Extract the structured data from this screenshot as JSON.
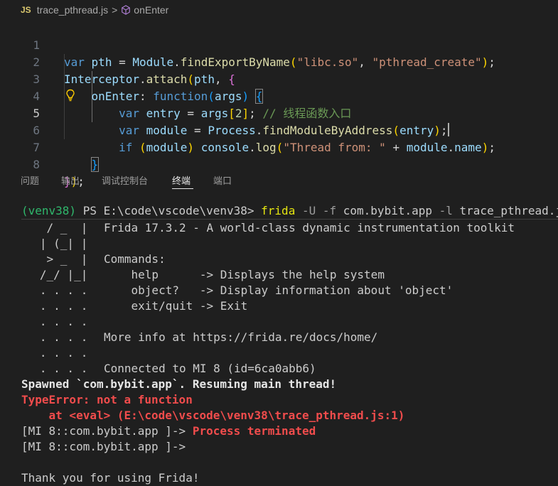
{
  "breadcrumb": {
    "file_badge": "JS",
    "file_name": "trace_pthread.js",
    "separator": ">",
    "symbol": "onEnter"
  },
  "editor": {
    "line_numbers": [
      "1",
      "2",
      "3",
      "4",
      "5",
      "6",
      "7",
      "8"
    ],
    "active_line": "5",
    "line1": {
      "kw": "var",
      "name": "pth",
      "eq": " = ",
      "obj": "Module",
      "dot": ".",
      "fn": "findExportByName",
      "open": "(",
      "s1": "\"libc.so\"",
      "comma": ", ",
      "s2": "\"pthread_create\"",
      "close": ")",
      "semi": ";"
    },
    "line2": {
      "obj": "Interceptor",
      "dot": ".",
      "fn": "attach",
      "open": "(",
      "arg": "pth",
      "comma": ", ",
      "brace": "{"
    },
    "line3": {
      "prop": "onEnter",
      "colon": ": ",
      "kw": "function",
      "open": "(",
      "arg": "args",
      "close": ")",
      "sp": " ",
      "brace": "{"
    },
    "line4": {
      "kw": "var",
      "name": "entry",
      "eq": " = ",
      "arr": "args",
      "lb": "[",
      "idx": "2",
      "rb": "]",
      "semi": ";",
      "comment": " // 线程函数入口"
    },
    "line5": {
      "kw": "var",
      "name": "module",
      "eq": " = ",
      "obj": "Process",
      "dot": ".",
      "fn": "findModuleByAddress",
      "open": "(",
      "arg": "entry",
      "close": ")",
      "semi": ";"
    },
    "line6": {
      "kw": "if",
      "sp": " ",
      "open": "(",
      "arg": "module",
      "close": ")",
      "sp2": " ",
      "obj": "console",
      "dot": ".",
      "fn": "log",
      "open2": "(",
      "str": "\"Thread from: \"",
      "plus": " + ",
      "v1": "module",
      "dot2": ".",
      "v2": "name",
      "close2": ")",
      "semi": ";"
    },
    "line7": {
      "brace": "}"
    },
    "line8": {
      "brace": "}",
      "close": ")",
      "semi": ";"
    }
  },
  "panel": {
    "tabs": [
      "问题",
      "输出",
      "调试控制台",
      "终端",
      "端口"
    ],
    "active_tab": "终端"
  },
  "terminal": {
    "prompt_env": "(venv38)",
    "prompt_ps": " PS E:\\code\\vscode\\venv38> ",
    "cmd": "frida",
    "flag1": " -U -f ",
    "pkg": "com.bybit.app",
    "flag2": " -l ",
    "script": "trace_pthread.js",
    "banner_left": [
      "    / _  |",
      "   | (_| |",
      "    > _  |",
      "   /_/ |_|",
      "   . . . .",
      "   . . . .",
      "   . . . .",
      "   . . . .",
      "   . . . .",
      "   . . . ."
    ],
    "banner_right": [
      "Frida 17.3.2 - A world-class dynamic instrumentation toolkit",
      "",
      "Commands:",
      "    help      -> Displays the help system",
      "    object?   -> Display information about 'object'",
      "    exit/quit -> Exit",
      "",
      "More info at https://frida.re/docs/home/",
      "",
      "Connected to MI 8 (id=6ca0abb6)"
    ],
    "spawned": "Spawned `com.bybit.app`. Resuming main thread!",
    "error": "TypeError: not a function",
    "error_at": "    at <eval> (E:\\code\\vscode\\venv38\\trace_pthread.js:1)",
    "repl_prompt": "[MI 8::com.bybit.app ]-> ",
    "terminated": "Process terminated",
    "repl_prompt2": "[MI 8::com.bybit.app ]->",
    "goodbye": "Thank you for using Frida!"
  },
  "colors": {
    "background": "#1f1f1f",
    "keyword": "#569cd6",
    "variable": "#9cdcfe",
    "function": "#dcdcaa",
    "string": "#ce9178",
    "comment": "#6a9955",
    "terminal_green": "#2fb86c",
    "terminal_yellow": "#e5e510",
    "terminal_red": "#f14c4c"
  }
}
